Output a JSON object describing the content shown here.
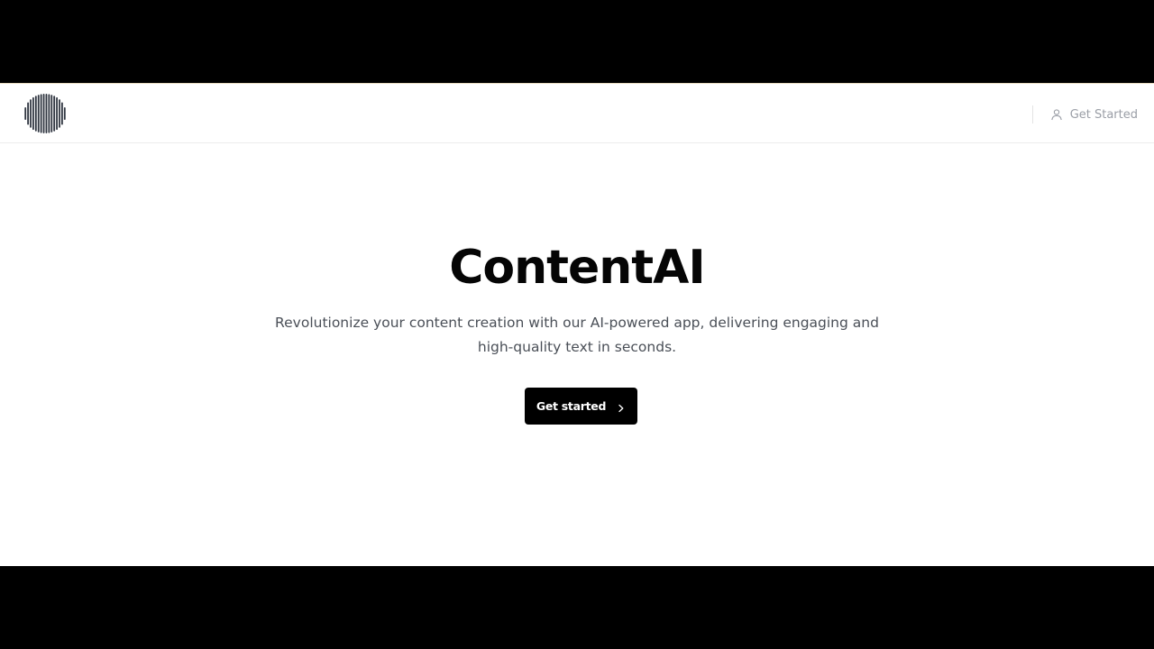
{
  "header": {
    "logo_icon": "soundwave-logo-icon",
    "cta_label": "Get Started",
    "cta_icon": "user-icon"
  },
  "hero": {
    "title": "ContentAI",
    "subtitle": "Revolutionize your content creation with our AI-powered app, delivering engaging and high-quality text in seconds.",
    "button_label": "Get started",
    "button_icon": "chevron-right-icon"
  },
  "colors": {
    "background": "#ffffff",
    "letterbox": "#000000",
    "title": "#050505",
    "subtitle": "#4a4f57",
    "button_bg": "#000000",
    "button_text": "#ffffff",
    "header_cta": "#9a9ea6"
  }
}
